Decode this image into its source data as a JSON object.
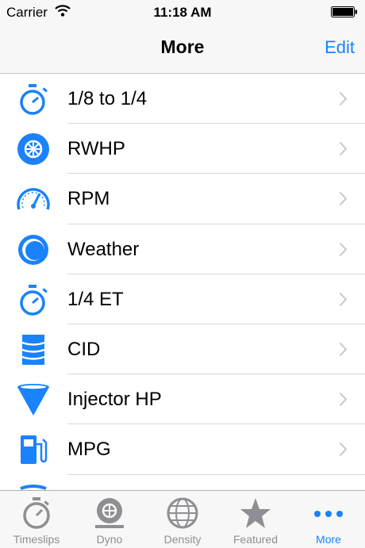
{
  "status_bar": {
    "carrier": "Carrier",
    "time": "11:18 AM"
  },
  "nav": {
    "title": "More",
    "edit_label": "Edit"
  },
  "list": [
    {
      "label": "1/8 to 1/4",
      "icon": "stopwatch-icon"
    },
    {
      "label": "RWHP",
      "icon": "wheel-icon"
    },
    {
      "label": "RPM",
      "icon": "tachometer-icon"
    },
    {
      "label": "Weather",
      "icon": "weather-icon"
    },
    {
      "label": "1/4 ET",
      "icon": "stopwatch-icon"
    },
    {
      "label": "CID",
      "icon": "cylinder-icon"
    },
    {
      "label": "Injector HP",
      "icon": "injector-icon"
    },
    {
      "label": "MPG",
      "icon": "fuel-pump-icon"
    }
  ],
  "tabs": [
    {
      "label": "Timeslips",
      "icon": "stopwatch-icon"
    },
    {
      "label": "Dyno",
      "icon": "dyno-icon"
    },
    {
      "label": "Density",
      "icon": "globe-icon"
    },
    {
      "label": "Featured",
      "icon": "star-icon"
    },
    {
      "label": "More",
      "icon": "more-dots-icon",
      "active": true
    }
  ],
  "colors": {
    "accent": "#1a82fb",
    "inactive": "#8e8e93",
    "bar_bg": "#f7f7f7"
  }
}
